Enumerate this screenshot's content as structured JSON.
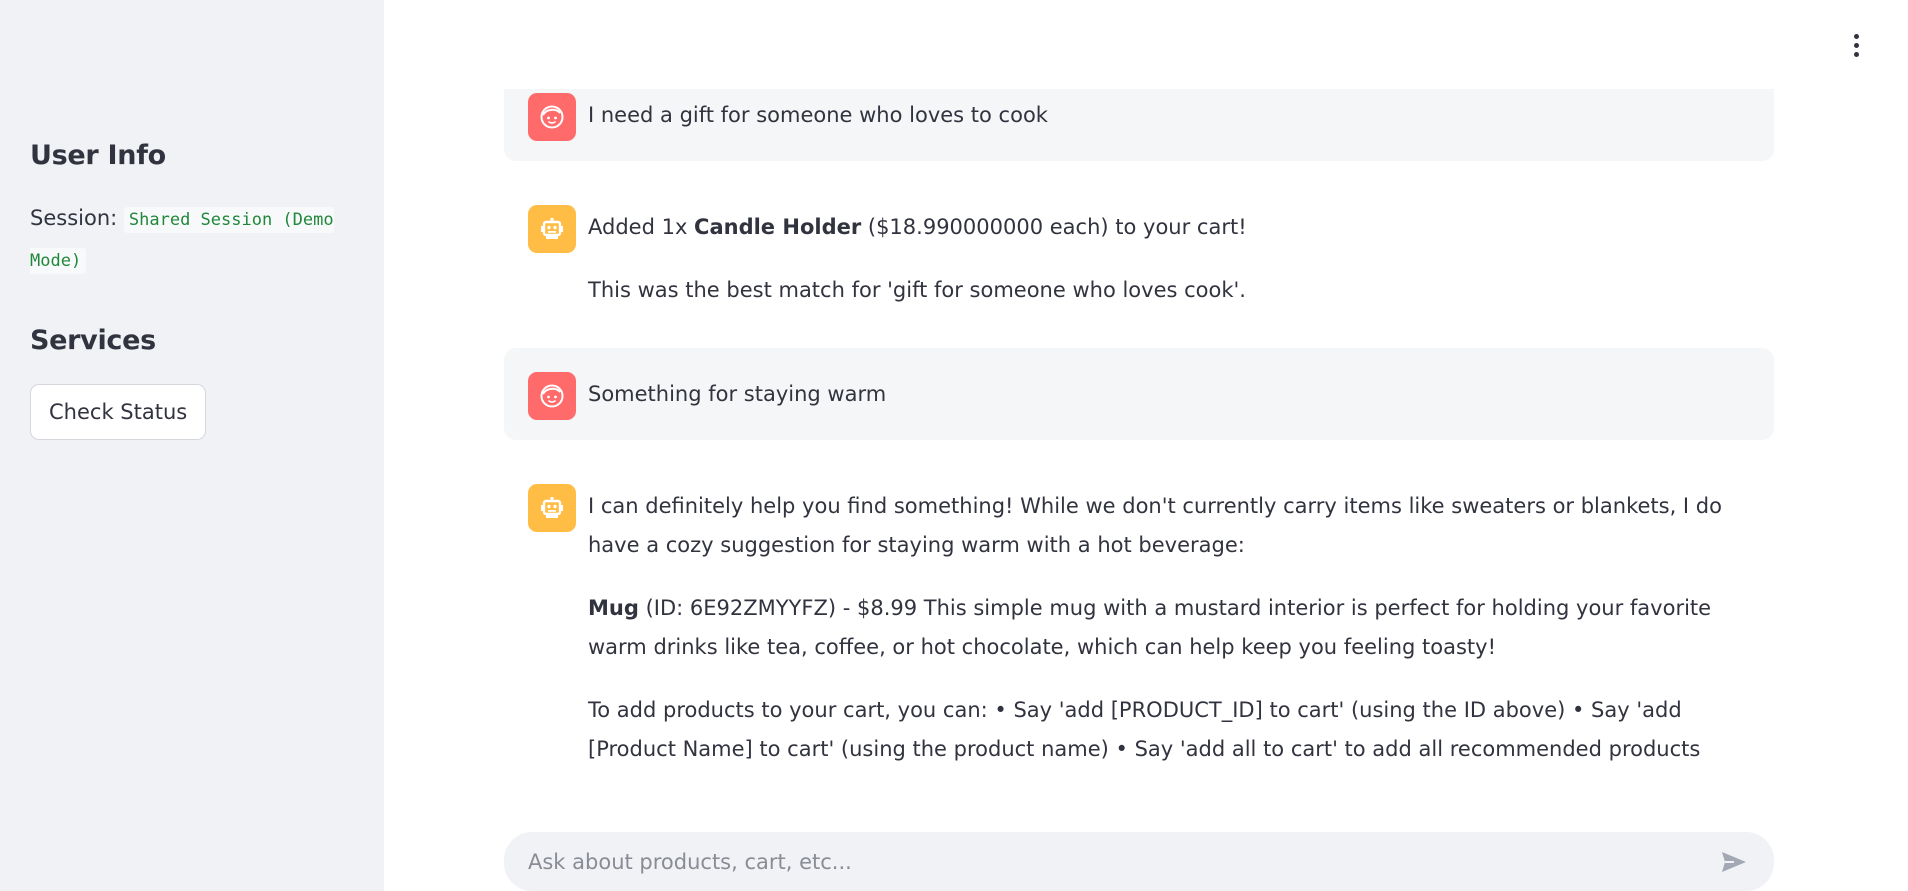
{
  "sidebar": {
    "user_info_title": "User Info",
    "session_label": "Session:",
    "session_value": "Shared Session (Demo Mode)",
    "services_title": "Services",
    "check_status_label": "Check Status"
  },
  "messages": [
    {
      "role": "user",
      "text": "I need a gift for someone who loves to cook"
    },
    {
      "role": "assistant",
      "p1_prefix": "Added 1x ",
      "p1_bold": "Candle Holder",
      "p1_suffix": " ($18.990000000 each) to your cart!",
      "p2": "This was the best match for 'gift for someone who loves cook'."
    },
    {
      "role": "user",
      "text": "Something for staying warm"
    },
    {
      "role": "assistant",
      "p1": "I can definitely help you find something! While we don't currently carry items like sweaters or blankets, I do have a cozy suggestion for staying warm with a hot beverage:",
      "p2_bold": "Mug",
      "p2_rest": " (ID: 6E92ZMYYFZ) - $8.99 This simple mug with a mustard interior is perfect for holding your favorite warm drinks like tea, coffee, or hot chocolate, which can help keep you feeling toasty!",
      "p3": "To add products to your cart, you can: • Say 'add [PRODUCT_ID] to cart' (using the ID above) • Say 'add [Product Name] to cart' (using the product name) • Say 'add all to cart' to add all recommended products"
    }
  ],
  "input": {
    "placeholder": "Ask about products, cart, etc..."
  },
  "icons": {
    "menu": "kebab-menu-icon",
    "user_avatar": "user-face-icon",
    "bot_avatar": "robot-icon",
    "send": "send-icon"
  },
  "colors": {
    "user_avatar_bg": "#ff6b6b",
    "bot_avatar_bg": "#ffbd45",
    "sidebar_bg": "#f0f2f6",
    "code_text": "#21883a"
  }
}
